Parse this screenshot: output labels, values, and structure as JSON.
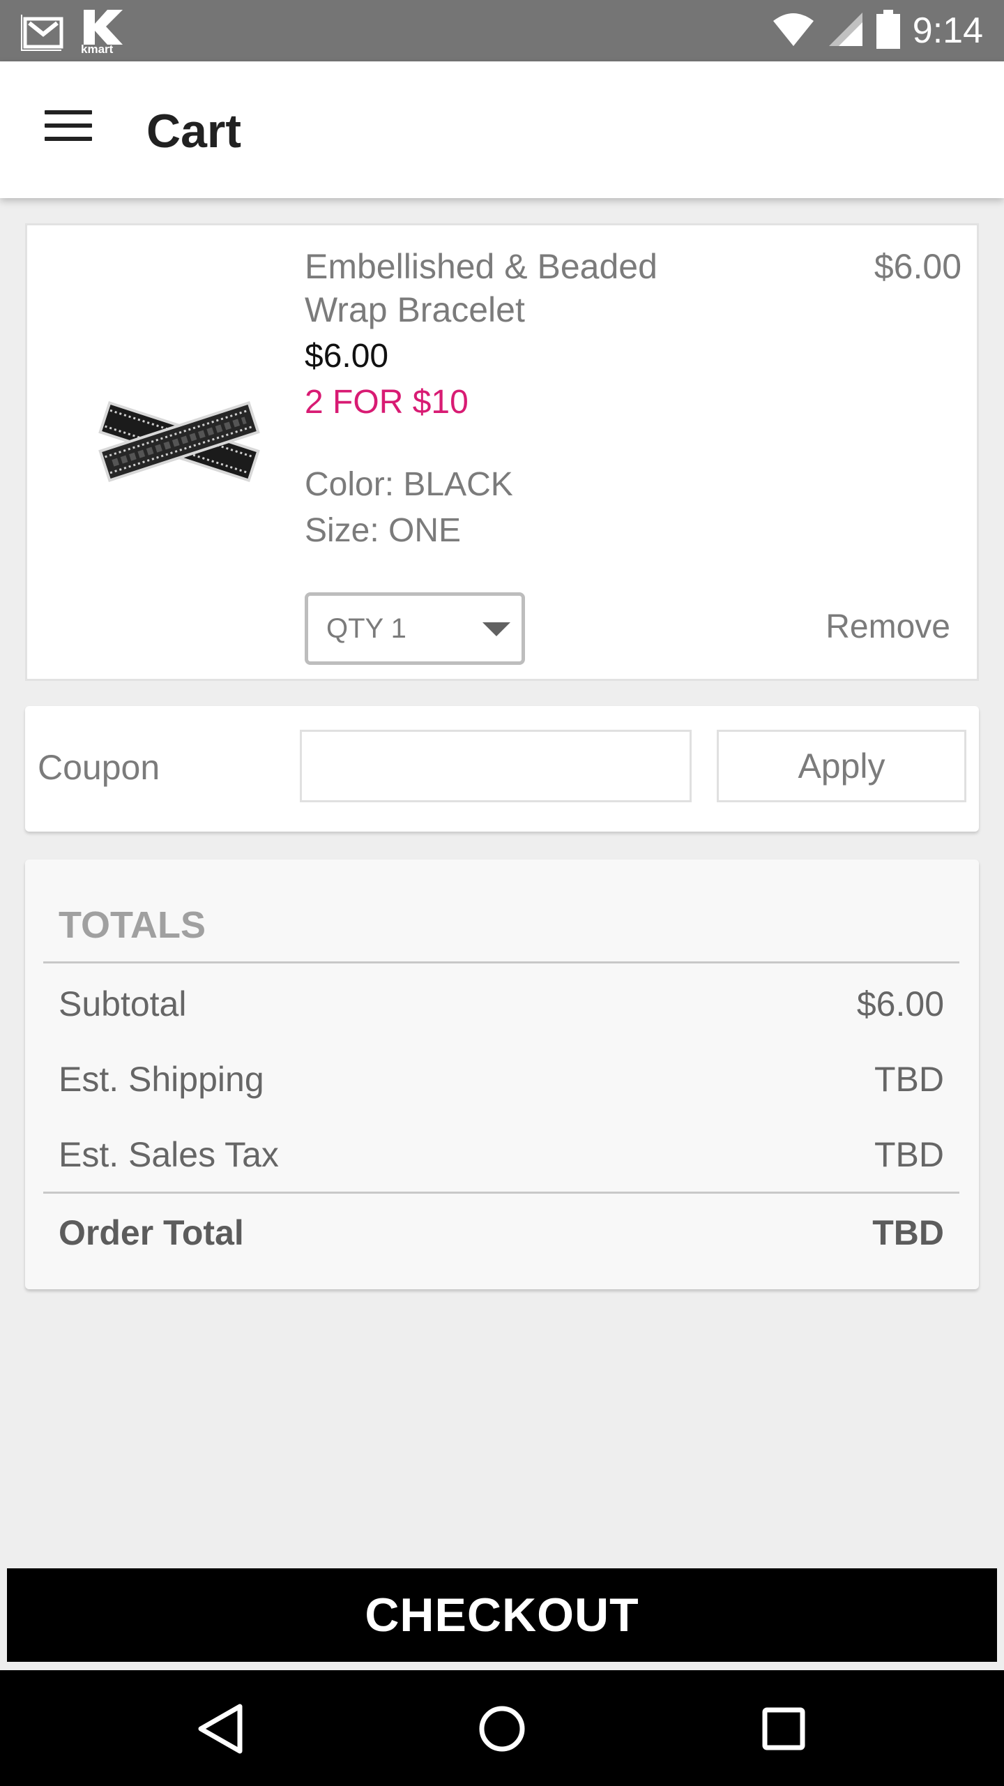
{
  "status_bar": {
    "time": "9:14",
    "icons": [
      "gmail-icon",
      "kmart-icon",
      "wifi-icon",
      "signal-icon",
      "battery-icon"
    ],
    "kmart_text": "kmart"
  },
  "app_bar": {
    "title": "Cart",
    "menu_icon": "hamburger-menu-icon"
  },
  "cart_item": {
    "name": "Embellished & Beaded Wrap Bracelet",
    "line_total": "$6.00",
    "price": "$6.00",
    "promo": "2 FOR $10",
    "color": "Color: BLACK",
    "size": "Size: ONE",
    "quantity_label": "QTY 1",
    "remove_label": "Remove",
    "promo_color": "#d81b73"
  },
  "coupon": {
    "label": "Coupon",
    "input_value": "",
    "apply_label": "Apply"
  },
  "totals": {
    "heading": "TOTALS",
    "rows": [
      {
        "label": "Subtotal",
        "value": "$6.00"
      },
      {
        "label": "Est. Shipping",
        "value": "TBD"
      },
      {
        "label": "Est. Sales Tax",
        "value": "TBD"
      }
    ],
    "order_total_label": "Order Total",
    "order_total_value": "TBD"
  },
  "checkout": {
    "label": "CHECKOUT"
  },
  "nav_bar": {
    "icons": [
      "back-icon",
      "home-icon",
      "recents-icon"
    ]
  }
}
